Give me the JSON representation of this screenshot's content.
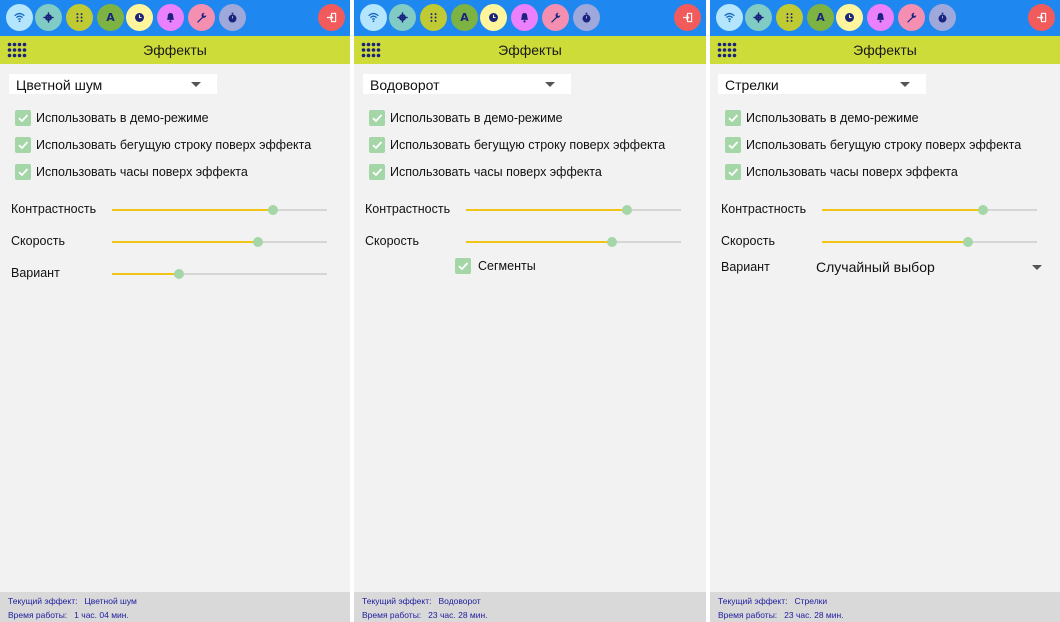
{
  "colors": {
    "topbar": "#1e88f0",
    "titlebar": "#cddc39",
    "background": "#f2f2f2",
    "footer": "#d9d9d9",
    "footer_text": "#2020a0",
    "checkbox": "#a5d6a7",
    "slider_fill": "#f2c418",
    "slider_knob": "#a5d6a7",
    "exit_button": "#f25b5b"
  },
  "toolbar": {
    "buttons": [
      {
        "icon": "wifi-icon",
        "color": "#b3e5fc"
      },
      {
        "icon": "gear-icon",
        "color": "#80cbc4"
      },
      {
        "icon": "dots-grid-icon",
        "color": "#c0ca33"
      },
      {
        "icon": "letter-a-icon",
        "color": "#7cb342",
        "glyph": "A"
      },
      {
        "icon": "clock-icon",
        "color": "#fff59d"
      },
      {
        "icon": "bell-icon",
        "color": "#ea80fc"
      },
      {
        "icon": "wrench-icon",
        "color": "#f48fb1"
      },
      {
        "icon": "stopwatch-icon",
        "color": "#9fa8da"
      }
    ],
    "exit_icon": "exit-icon"
  },
  "panels": [
    {
      "title": "Эффекты",
      "effect_select": "Цветной шум",
      "checkboxes": [
        {
          "label": "Использовать в демо-режиме",
          "checked": true
        },
        {
          "label": "Использовать бегущую строку поверх эффекта",
          "checked": true
        },
        {
          "label": "Использовать часы поверх эффекта",
          "checked": true
        }
      ],
      "sliders": [
        {
          "label": "Контрастность",
          "value": 0.75
        },
        {
          "label": "Скорость",
          "value": 0.68
        },
        {
          "label": "Вариант",
          "value": 0.31
        }
      ],
      "footer": {
        "current_effect_label": "Текущий эффект:",
        "current_effect_value": "Цветной шум",
        "uptime_label": "Время работы:",
        "uptime_value": "1 час. 04 мин."
      }
    },
    {
      "title": "Эффекты",
      "effect_select": "Водоворот",
      "checkboxes": [
        {
          "label": "Использовать в демо-режиме",
          "checked": true
        },
        {
          "label": "Использовать бегущую строку поверх эффекта",
          "checked": true
        },
        {
          "label": "Использовать часы поверх эффекта",
          "checked": true
        }
      ],
      "sliders": [
        {
          "label": "Контрастность",
          "value": 0.75
        },
        {
          "label": "Скорость",
          "value": 0.68
        }
      ],
      "segments": {
        "label": "Сегменты",
        "checked": true
      },
      "footer": {
        "current_effect_label": "Текущий эффект:",
        "current_effect_value": "Водоворот",
        "uptime_label": "Время работы:",
        "uptime_value": "23 час. 28 мин."
      }
    },
    {
      "title": "Эффекты",
      "effect_select": "Стрелки",
      "checkboxes": [
        {
          "label": "Использовать в демо-режиме",
          "checked": true
        },
        {
          "label": "Использовать бегущую строку поверх эффекта",
          "checked": true
        },
        {
          "label": "Использовать часы поверх эффекта",
          "checked": true
        }
      ],
      "sliders": [
        {
          "label": "Контрастность",
          "value": 0.75
        },
        {
          "label": "Скорость",
          "value": 0.68
        }
      ],
      "variant": {
        "label": "Вариант",
        "value": "Случайный выбор"
      },
      "footer": {
        "current_effect_label": "Текущий эффект:",
        "current_effect_value": "Стрелки",
        "uptime_label": "Время работы:",
        "uptime_value": "23 час. 28 мин."
      }
    }
  ]
}
